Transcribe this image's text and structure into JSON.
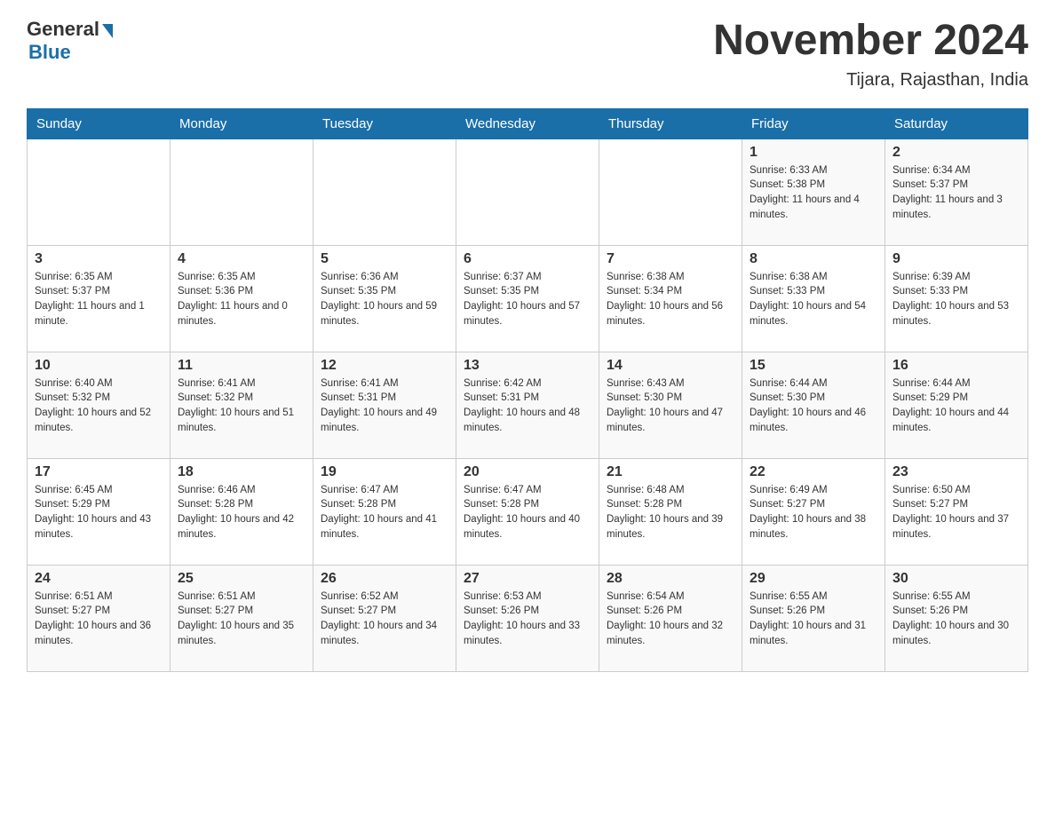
{
  "header": {
    "logo_general": "General",
    "logo_blue": "Blue",
    "month_title": "November 2024",
    "location": "Tijara, Rajasthan, India"
  },
  "weekdays": [
    "Sunday",
    "Monday",
    "Tuesday",
    "Wednesday",
    "Thursday",
    "Friday",
    "Saturday"
  ],
  "weeks": [
    [
      {
        "day": "",
        "info": ""
      },
      {
        "day": "",
        "info": ""
      },
      {
        "day": "",
        "info": ""
      },
      {
        "day": "",
        "info": ""
      },
      {
        "day": "",
        "info": ""
      },
      {
        "day": "1",
        "info": "Sunrise: 6:33 AM\nSunset: 5:38 PM\nDaylight: 11 hours and 4 minutes."
      },
      {
        "day": "2",
        "info": "Sunrise: 6:34 AM\nSunset: 5:37 PM\nDaylight: 11 hours and 3 minutes."
      }
    ],
    [
      {
        "day": "3",
        "info": "Sunrise: 6:35 AM\nSunset: 5:37 PM\nDaylight: 11 hours and 1 minute."
      },
      {
        "day": "4",
        "info": "Sunrise: 6:35 AM\nSunset: 5:36 PM\nDaylight: 11 hours and 0 minutes."
      },
      {
        "day": "5",
        "info": "Sunrise: 6:36 AM\nSunset: 5:35 PM\nDaylight: 10 hours and 59 minutes."
      },
      {
        "day": "6",
        "info": "Sunrise: 6:37 AM\nSunset: 5:35 PM\nDaylight: 10 hours and 57 minutes."
      },
      {
        "day": "7",
        "info": "Sunrise: 6:38 AM\nSunset: 5:34 PM\nDaylight: 10 hours and 56 minutes."
      },
      {
        "day": "8",
        "info": "Sunrise: 6:38 AM\nSunset: 5:33 PM\nDaylight: 10 hours and 54 minutes."
      },
      {
        "day": "9",
        "info": "Sunrise: 6:39 AM\nSunset: 5:33 PM\nDaylight: 10 hours and 53 minutes."
      }
    ],
    [
      {
        "day": "10",
        "info": "Sunrise: 6:40 AM\nSunset: 5:32 PM\nDaylight: 10 hours and 52 minutes."
      },
      {
        "day": "11",
        "info": "Sunrise: 6:41 AM\nSunset: 5:32 PM\nDaylight: 10 hours and 51 minutes."
      },
      {
        "day": "12",
        "info": "Sunrise: 6:41 AM\nSunset: 5:31 PM\nDaylight: 10 hours and 49 minutes."
      },
      {
        "day": "13",
        "info": "Sunrise: 6:42 AM\nSunset: 5:31 PM\nDaylight: 10 hours and 48 minutes."
      },
      {
        "day": "14",
        "info": "Sunrise: 6:43 AM\nSunset: 5:30 PM\nDaylight: 10 hours and 47 minutes."
      },
      {
        "day": "15",
        "info": "Sunrise: 6:44 AM\nSunset: 5:30 PM\nDaylight: 10 hours and 46 minutes."
      },
      {
        "day": "16",
        "info": "Sunrise: 6:44 AM\nSunset: 5:29 PM\nDaylight: 10 hours and 44 minutes."
      }
    ],
    [
      {
        "day": "17",
        "info": "Sunrise: 6:45 AM\nSunset: 5:29 PM\nDaylight: 10 hours and 43 minutes."
      },
      {
        "day": "18",
        "info": "Sunrise: 6:46 AM\nSunset: 5:28 PM\nDaylight: 10 hours and 42 minutes."
      },
      {
        "day": "19",
        "info": "Sunrise: 6:47 AM\nSunset: 5:28 PM\nDaylight: 10 hours and 41 minutes."
      },
      {
        "day": "20",
        "info": "Sunrise: 6:47 AM\nSunset: 5:28 PM\nDaylight: 10 hours and 40 minutes."
      },
      {
        "day": "21",
        "info": "Sunrise: 6:48 AM\nSunset: 5:28 PM\nDaylight: 10 hours and 39 minutes."
      },
      {
        "day": "22",
        "info": "Sunrise: 6:49 AM\nSunset: 5:27 PM\nDaylight: 10 hours and 38 minutes."
      },
      {
        "day": "23",
        "info": "Sunrise: 6:50 AM\nSunset: 5:27 PM\nDaylight: 10 hours and 37 minutes."
      }
    ],
    [
      {
        "day": "24",
        "info": "Sunrise: 6:51 AM\nSunset: 5:27 PM\nDaylight: 10 hours and 36 minutes."
      },
      {
        "day": "25",
        "info": "Sunrise: 6:51 AM\nSunset: 5:27 PM\nDaylight: 10 hours and 35 minutes."
      },
      {
        "day": "26",
        "info": "Sunrise: 6:52 AM\nSunset: 5:27 PM\nDaylight: 10 hours and 34 minutes."
      },
      {
        "day": "27",
        "info": "Sunrise: 6:53 AM\nSunset: 5:26 PM\nDaylight: 10 hours and 33 minutes."
      },
      {
        "day": "28",
        "info": "Sunrise: 6:54 AM\nSunset: 5:26 PM\nDaylight: 10 hours and 32 minutes."
      },
      {
        "day": "29",
        "info": "Sunrise: 6:55 AM\nSunset: 5:26 PM\nDaylight: 10 hours and 31 minutes."
      },
      {
        "day": "30",
        "info": "Sunrise: 6:55 AM\nSunset: 5:26 PM\nDaylight: 10 hours and 30 minutes."
      }
    ]
  ]
}
